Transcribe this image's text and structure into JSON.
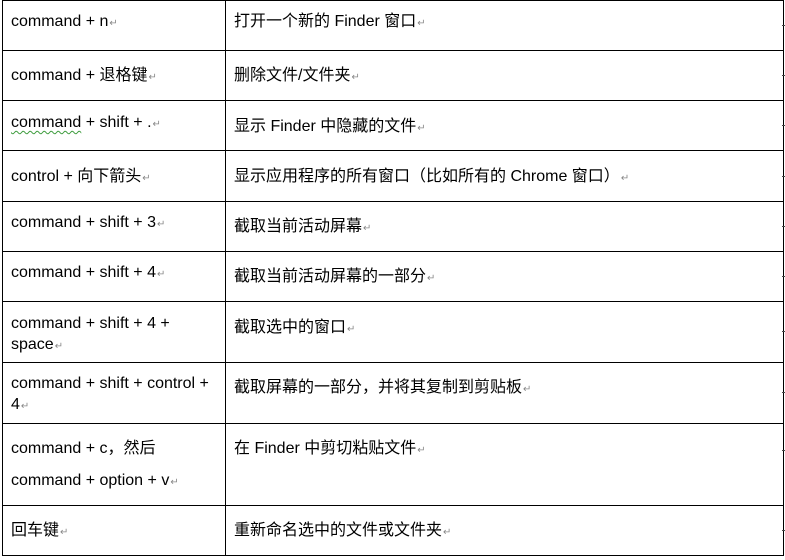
{
  "document": {
    "paragraph_mark": "↵",
    "table": {
      "rows": [
        {
          "key": "command + n",
          "desc": "打开一个新的 Finder 窗口"
        },
        {
          "key": "command + 退格键",
          "desc": "删除文件/文件夹"
        },
        {
          "key_prefix": "command",
          "key_rest": " + shift + .",
          "desc": "显示 Finder 中隐藏的文件",
          "spellcheck_flag": true
        },
        {
          "key": "control + 向下箭头",
          "desc": "显示应用程序的所有窗口（比如所有的 Chrome 窗口）"
        },
        {
          "key": "command + shift + 3",
          "desc": "截取当前活动屏幕"
        },
        {
          "key": "command + shift + 4",
          "desc": "截取当前活动屏幕的一部分"
        },
        {
          "key": "command + shift + 4 + space",
          "desc": "截取选中的窗口"
        },
        {
          "key": "command + shift + control + 4",
          "desc": "截取屏幕的一部分，并将其复制到剪贴板"
        },
        {
          "key_line1": "command + c，然后",
          "key_line2": "command + option + v",
          "desc": "在 Finder 中剪切粘贴文件"
        },
        {
          "key": "回车键",
          "desc": "重新命名选中的文件或文件夹"
        }
      ]
    }
  }
}
